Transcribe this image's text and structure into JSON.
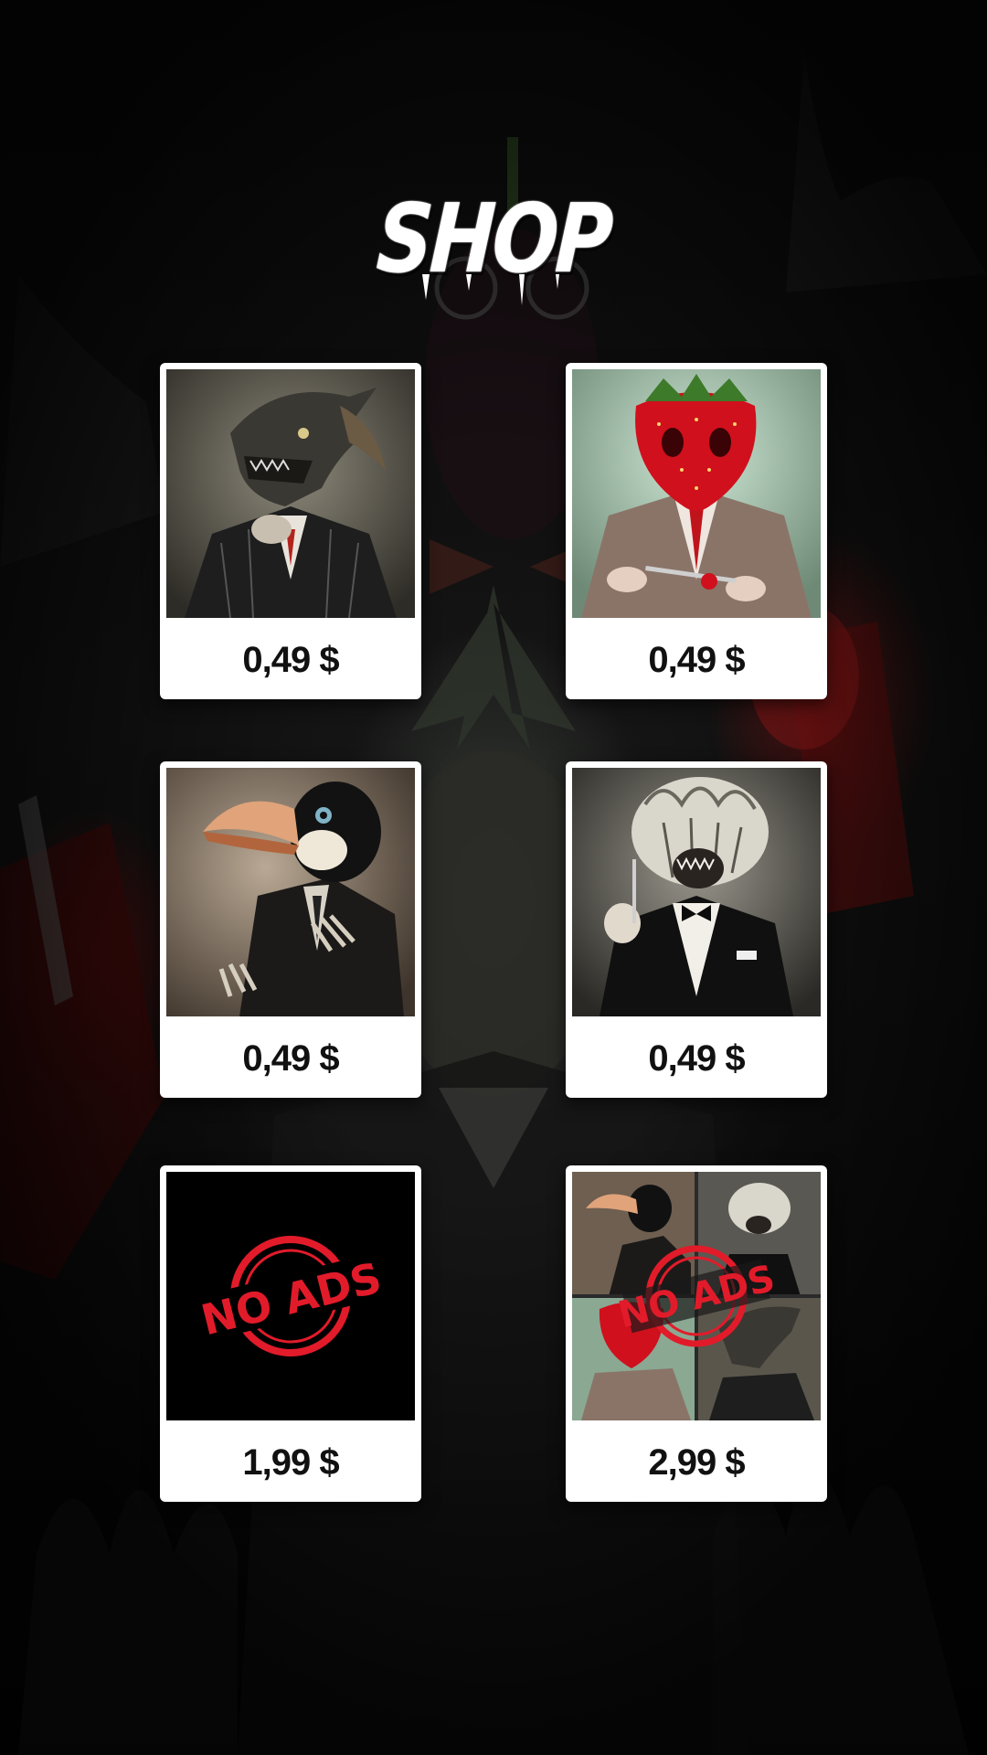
{
  "screen": {
    "title": "SHOP"
  },
  "items": [
    {
      "art": "dragon-suit-portrait",
      "price": "0,49 $"
    },
    {
      "art": "strawberry-suit-portrait",
      "price": "0,49 $"
    },
    {
      "art": "toucan-suit-portrait",
      "price": "0,49 $"
    },
    {
      "art": "cabbage-tuxedo-portrait",
      "price": "0,49 $"
    },
    {
      "art": "no-ads-stamp",
      "badge": "NO ADS",
      "price": "1,99 $"
    },
    {
      "art": "bundle-collage-no-ads",
      "badge": "NO ADS",
      "price": "2,99 $"
    }
  ],
  "colors": {
    "card_background": "#ffffff",
    "price_text": "#111111",
    "stamp_red": "#e21b2a",
    "title_text": "#ffffff"
  }
}
